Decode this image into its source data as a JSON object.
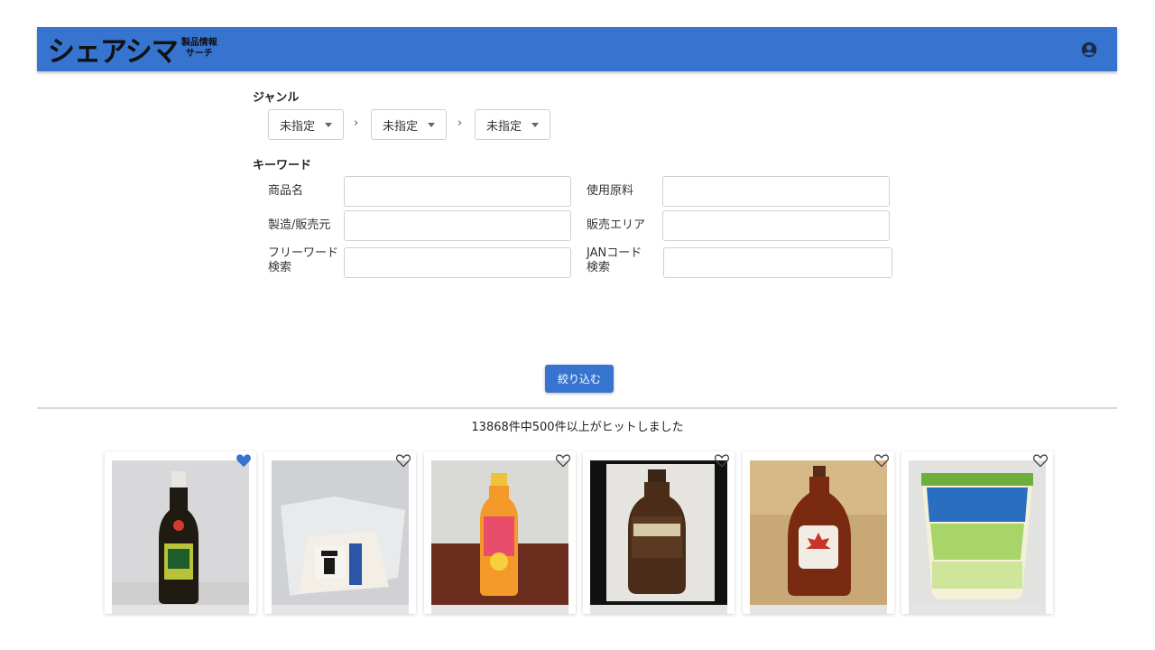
{
  "header": {
    "logo_main": "シェアシマ",
    "logo_sub_1": "製品情報",
    "logo_sub_2": "サーチ",
    "account_icon": "account-circle-icon",
    "bar_color": "#3674cf"
  },
  "genre": {
    "label": "ジャンル",
    "selects": [
      "未指定",
      "未指定",
      "未指定"
    ],
    "separator": "›"
  },
  "keyword": {
    "label": "キーワード",
    "fields": {
      "product_name": {
        "label": "商品名",
        "value": ""
      },
      "ingredients": {
        "label": "使用原料",
        "value": ""
      },
      "maker": {
        "label": "製造/販売元",
        "value": ""
      },
      "sales_area": {
        "label": "販売エリア",
        "value": ""
      },
      "free_word_1": "フリーワード",
      "free_word_2": "検索",
      "free_word_value": "",
      "jan_1": "JANコード",
      "jan_2": "検索",
      "jan_value": ""
    }
  },
  "filter_button": "絞り込む",
  "result_text": "13868件中500件以上がヒットしました",
  "products": [
    {
      "name": "soy-sauce-bottle",
      "favorited": true
    },
    {
      "name": "tofu-pack",
      "favorited": false
    },
    {
      "name": "fruit-punch-bottle",
      "favorited": false
    },
    {
      "name": "hersheys-syrup",
      "favorited": false
    },
    {
      "name": "maple-syrup",
      "favorited": false
    },
    {
      "name": "bifix-yogurt",
      "favorited": false
    }
  ],
  "colors": {
    "accent": "#3674cf",
    "heart_filled": "#3674cf",
    "heart_outline": "#444444"
  }
}
